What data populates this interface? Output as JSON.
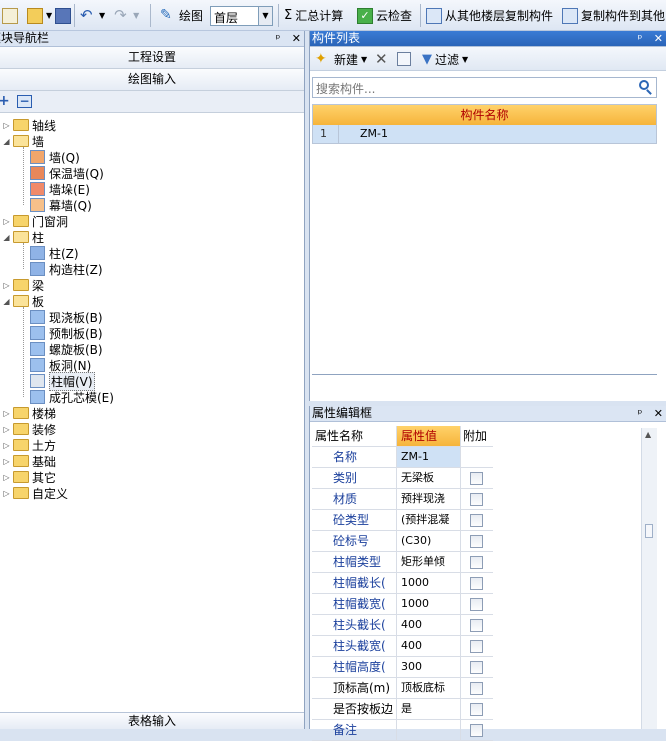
{
  "toolbar": {
    "draw_label": "绘图",
    "floor": "首层",
    "sum_label": "汇总计算",
    "cloud_label": "云检查",
    "copy_from_label": "从其他楼层复制构件",
    "copy_to_label": "复制构件到其他"
  },
  "left": {
    "title": "模块导航栏",
    "pin": "ᵖ",
    "close": "✕",
    "btn_project": "工程设置",
    "btn_draw": "绘图输入",
    "btn_table": "表格输入"
  },
  "tree": [
    {
      "label": "轴线"
    },
    {
      "label": "墙"
    },
    {
      "label": "墙(Q)"
    },
    {
      "label": "保温墙(Q)"
    },
    {
      "label": "墙垛(E)"
    },
    {
      "label": "幕墙(Q)"
    },
    {
      "label": "门窗洞"
    },
    {
      "label": "柱"
    },
    {
      "label": "柱(Z)"
    },
    {
      "label": "构造柱(Z)"
    },
    {
      "label": "梁"
    },
    {
      "label": "板"
    },
    {
      "label": "现浇板(B)"
    },
    {
      "label": "预制板(B)"
    },
    {
      "label": "螺旋板(B)"
    },
    {
      "label": "板洞(N)"
    },
    {
      "label": "柱帽(V)"
    },
    {
      "label": "成孔芯模(E)"
    },
    {
      "label": "楼梯"
    },
    {
      "label": "装修"
    },
    {
      "label": "土方"
    },
    {
      "label": "基础"
    },
    {
      "label": "其它"
    },
    {
      "label": "自定义"
    }
  ],
  "clist": {
    "title": "构件列表",
    "new_label": "新建",
    "filter_label": "过滤",
    "search_placeholder": "搜索构件...",
    "col_name": "构件名称",
    "rows": [
      {
        "index": "1",
        "name": "ZM-1"
      }
    ]
  },
  "props": {
    "title": "属性编辑框",
    "col_name": "属性名称",
    "col_value": "属性值",
    "col_extra": "附加",
    "rows": [
      {
        "name": "名称",
        "value": "ZM-1"
      },
      {
        "name": "类别",
        "value": "无梁板"
      },
      {
        "name": "材质",
        "value": "预拌现浇"
      },
      {
        "name": "砼类型",
        "value": "(预拌混凝"
      },
      {
        "name": "砼标号",
        "value": "(C30)"
      },
      {
        "name": "柱帽类型",
        "value": "矩形单倾"
      },
      {
        "name": "柱帽截长(",
        "value": "1000"
      },
      {
        "name": "柱帽截宽(",
        "value": "1000"
      },
      {
        "name": "柱头截长(",
        "value": "400"
      },
      {
        "name": "柱头截宽(",
        "value": "400"
      },
      {
        "name": "柱帽高度(",
        "value": "300"
      },
      {
        "name": "顶标高(m)",
        "value": "顶板底标"
      },
      {
        "name": "是否按板边",
        "value": "是"
      },
      {
        "name": "备注",
        "value": ""
      }
    ]
  }
}
